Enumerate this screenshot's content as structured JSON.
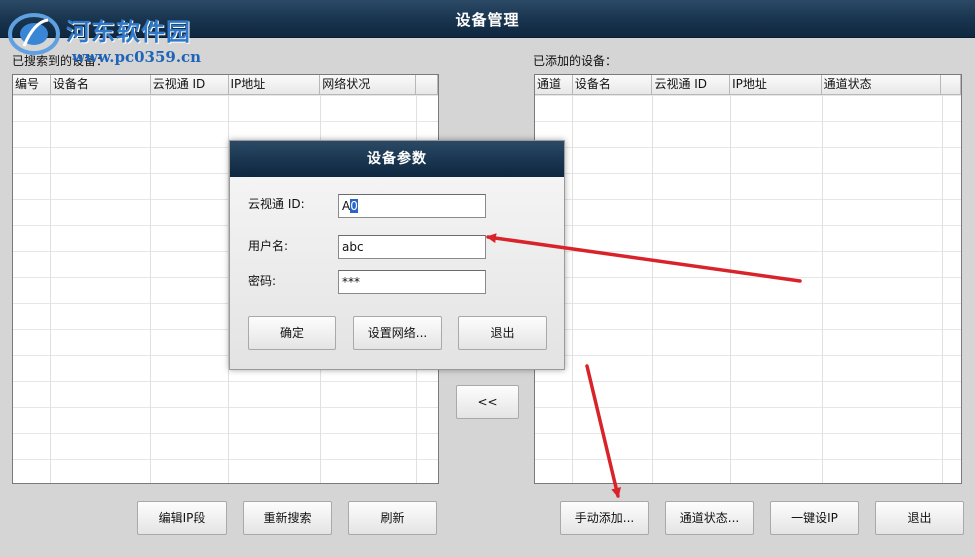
{
  "window": {
    "title": "设备管理"
  },
  "watermark": {
    "title": "河东软件园",
    "url": "www.pc0359.cn"
  },
  "left_panel": {
    "label": "已搜索到的设备：",
    "columns": [
      "编号",
      "设备名",
      "云视通 ID",
      "IP地址",
      "网络状况",
      ""
    ]
  },
  "right_panel": {
    "label": "已添加的设备：",
    "columns": [
      "通道",
      "设备名",
      "云视通 ID",
      "IP地址",
      "通道状态",
      ""
    ]
  },
  "transfer_button": {
    "label": "<<"
  },
  "bottom_left_buttons": {
    "edit_ip": "编辑IP段",
    "research": "重新搜索",
    "refresh": "刷新"
  },
  "bottom_right_buttons": {
    "manual_add": "手动添加...",
    "channel_status": "通道状态...",
    "one_click_ip": "一键设IP",
    "exit": "退出"
  },
  "dialog": {
    "title": "设备参数",
    "id_label": "云视通 ID:",
    "id_value_prefix": "A",
    "id_value_selected": "0",
    "user_label": "用户名:",
    "user_value": "abc",
    "password_label": "密码:",
    "password_value": "***",
    "ok": "确定",
    "network": "设置网络...",
    "exit": "退出"
  },
  "colors": {
    "titlebar": "#1a3550",
    "annotation_arrow": "#d9232a",
    "selection": "#2a64c8"
  }
}
